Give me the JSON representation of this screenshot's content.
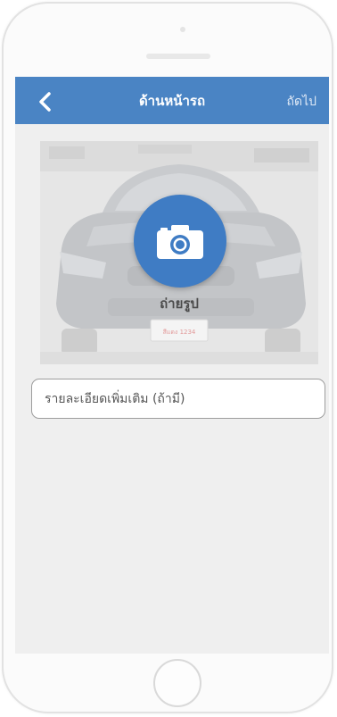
{
  "navbar": {
    "back_icon": "chevron-left-icon",
    "title": "ด้านหน้ารถ",
    "next_label": "ถัดไป"
  },
  "photo": {
    "camera_icon": "camera-icon",
    "capture_label": "ถ่ายรูป",
    "plate_text": "สีแดง 1234"
  },
  "details": {
    "placeholder": "รายละเอียดเพิ่มเติม (ถ้ามี)",
    "value": ""
  },
  "colors": {
    "navbar": "#4a84c4",
    "accent": "#3f7cc4",
    "screen_background": "#efefef"
  }
}
